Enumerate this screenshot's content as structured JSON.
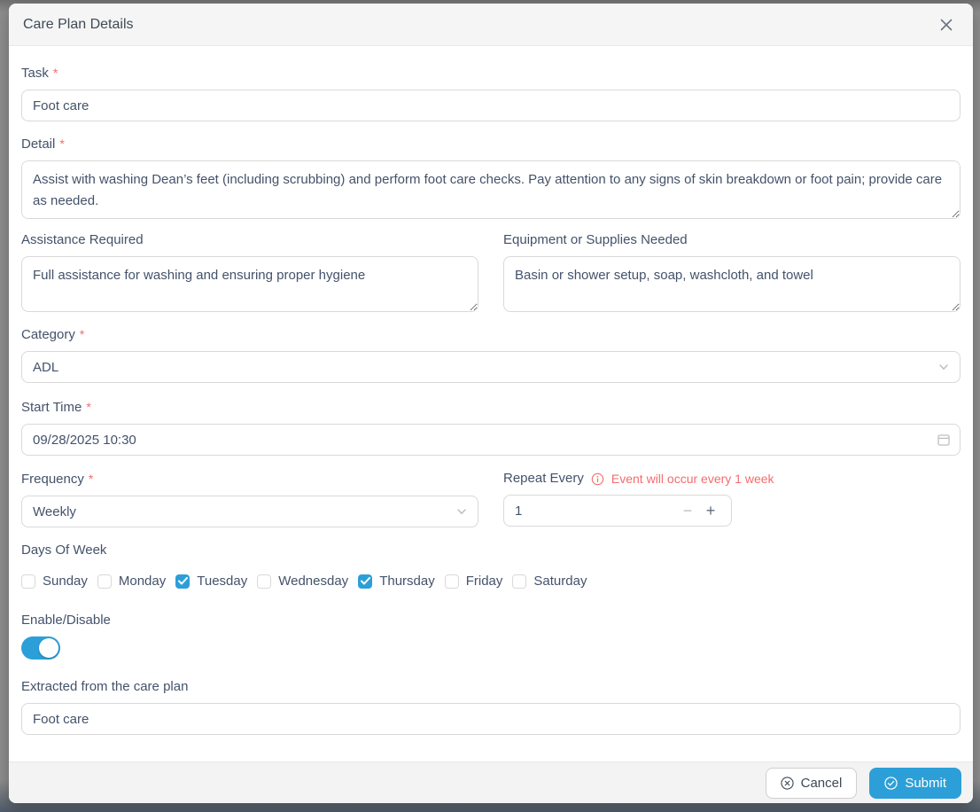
{
  "modal": {
    "title": "Care Plan Details"
  },
  "required_marker": "*",
  "fields": {
    "task": {
      "label": "Task",
      "required": true,
      "value": "Foot care"
    },
    "detail": {
      "label": "Detail",
      "required": true,
      "value": "Assist with washing Dean’s feet (including scrubbing) and perform foot care checks. Pay attention to any signs of skin breakdown or foot pain; provide care as needed."
    },
    "assistance": {
      "label": "Assistance Required",
      "value": "Full assistance for washing and ensuring proper hygiene"
    },
    "equipment": {
      "label": "Equipment or Supplies Needed",
      "value": "Basin or shower setup, soap, washcloth, and towel"
    },
    "category": {
      "label": "Category",
      "required": true,
      "value": "ADL"
    },
    "start_time": {
      "label": "Start Time",
      "required": true,
      "value": "09/28/2025 10:30"
    },
    "frequency": {
      "label": "Frequency",
      "required": true,
      "value": "Weekly"
    },
    "repeat_every": {
      "label": "Repeat Every",
      "warning": "Event will occur every 1 week",
      "value": "1",
      "minus": "−",
      "plus": "+"
    },
    "days_of_week": {
      "label": "Days Of Week",
      "options": [
        {
          "label": "Sunday",
          "checked": false
        },
        {
          "label": "Monday",
          "checked": false
        },
        {
          "label": "Tuesday",
          "checked": true
        },
        {
          "label": "Wednesday",
          "checked": false
        },
        {
          "label": "Thursday",
          "checked": true
        },
        {
          "label": "Friday",
          "checked": false
        },
        {
          "label": "Saturday",
          "checked": false
        }
      ]
    },
    "enable": {
      "label": "Enable/Disable",
      "on": true
    },
    "extracted": {
      "label": "Extracted from the care plan",
      "value": "Foot care"
    }
  },
  "footer": {
    "cancel_label": "Cancel",
    "submit_label": "Submit"
  },
  "colors": {
    "accent": "#2d9fd8",
    "danger": "#f56c6c"
  }
}
